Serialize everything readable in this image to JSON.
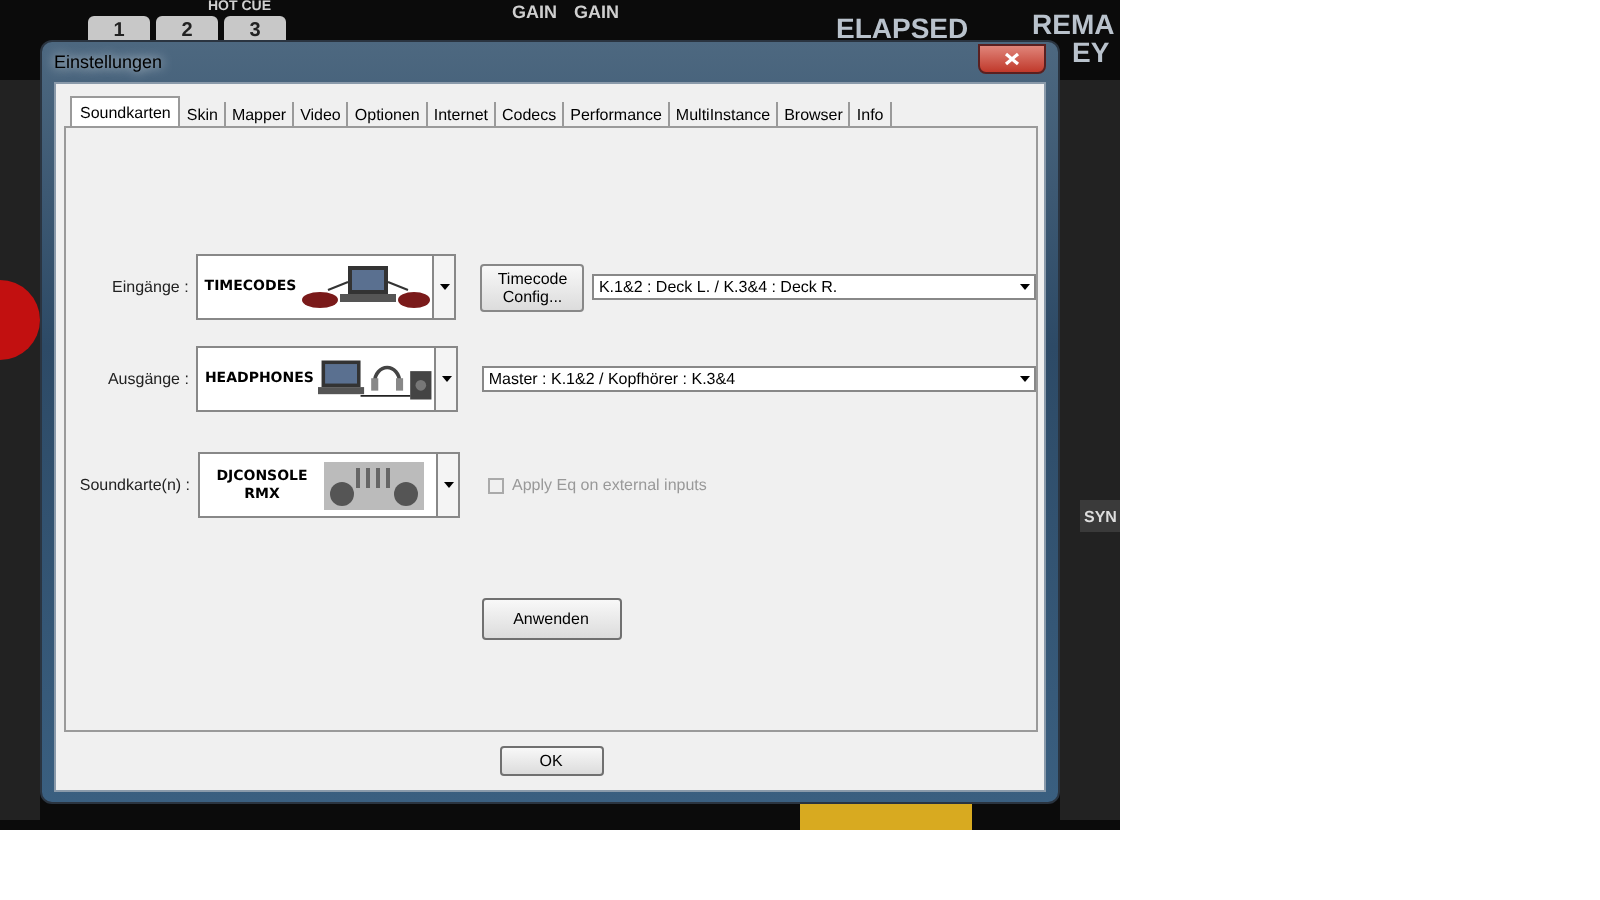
{
  "background_app": {
    "hot_cue_label": "HOT CUE",
    "hot_cue_buttons": [
      "1",
      "2",
      "3"
    ],
    "gain_labels": [
      "GAIN",
      "GAIN"
    ],
    "elapsed_label": "ELAPSED",
    "remain_label": "REMA",
    "key_label": "EY",
    "sync_button": "SYN"
  },
  "window": {
    "title": "Einstellungen"
  },
  "tabs": [
    {
      "label": "Soundkarten",
      "selected": true
    },
    {
      "label": "Skin",
      "selected": false
    },
    {
      "label": "Mapper",
      "selected": false
    },
    {
      "label": "Video",
      "selected": false
    },
    {
      "label": "Optionen",
      "selected": false
    },
    {
      "label": "Internet",
      "selected": false
    },
    {
      "label": "Codecs",
      "selected": false
    },
    {
      "label": "Performance",
      "selected": false
    },
    {
      "label": "MultiInstance",
      "selected": false
    },
    {
      "label": "Browser",
      "selected": false
    },
    {
      "label": "Info",
      "selected": false
    }
  ],
  "rows": [
    {
      "label": "Eingänge :",
      "device": {
        "kind": "timecodes",
        "text": "TIMECODES"
      },
      "config_button": "Timecode Config...",
      "selection": "K.1&2 : Deck L. / K.3&4 : Deck R."
    },
    {
      "label": "Ausgänge :",
      "device": {
        "kind": "headphones",
        "text": "HEADPHONES"
      },
      "selection": "Master : K.1&2 / Kopfhörer : K.3&4"
    },
    {
      "label": "Soundkarte(n) :",
      "device": {
        "kind": "console",
        "text": "DJCONSOLE RMX"
      },
      "option": {
        "label": "Apply Eq on external inputs",
        "checked": false,
        "disabled": true
      }
    }
  ],
  "apply_button": "Anwenden",
  "ok_button": "OK"
}
